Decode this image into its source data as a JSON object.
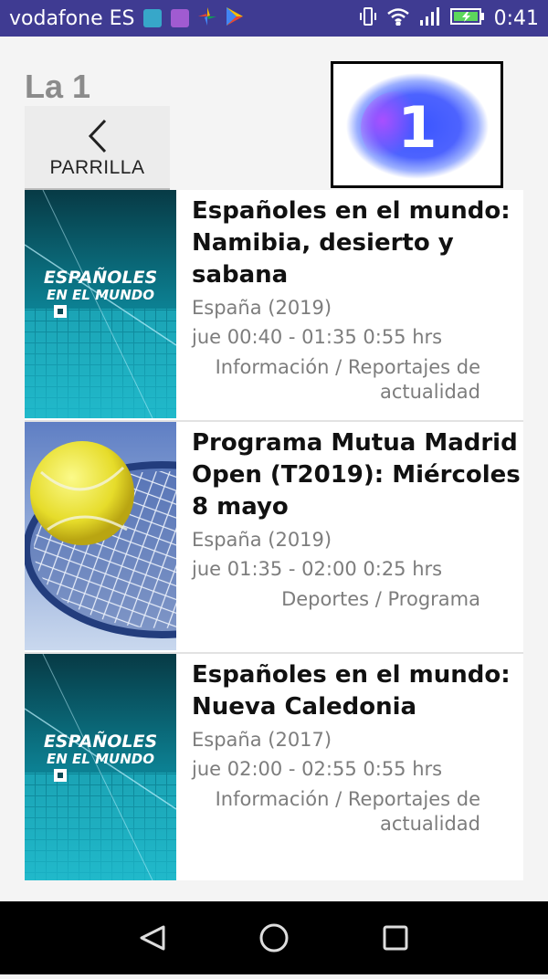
{
  "status_bar": {
    "carrier": "vodafone ES",
    "time": "0:41"
  },
  "header": {
    "channel_name": "La 1",
    "back_label": "PARRILLA",
    "logo_text": "1"
  },
  "programs": [
    {
      "title": "Españoles en el mundo: Namibia, desierto y sabana",
      "country": "España (2019)",
      "time": "jue 00:40 - 01:35 0:55 hrs",
      "genre": "Información / Reportajes de actualidad",
      "thumb_text_1": "ESPAÑOLES",
      "thumb_text_2": "EN EL MUNDO"
    },
    {
      "title": "Programa Mutua Madrid Open (T2019): Miércoles 8 mayo",
      "country": "España (2019)",
      "time": "jue 01:35 - 02:00 0:25 hrs",
      "genre": "Deportes / Programa"
    },
    {
      "title": "Españoles en el mundo: Nueva Caledonia",
      "country": "España (2017)",
      "time": "jue 02:00 - 02:55 0:55 hrs",
      "genre": "Información / Reportajes de actualidad",
      "thumb_text_1": "ESPAÑOLES",
      "thumb_text_2": "EN EL MUNDO"
    }
  ],
  "colors": {
    "status_bar": "#3f3b92",
    "logo_blue": "#3a55ff",
    "thumb_teal": "#1aa6b8"
  }
}
